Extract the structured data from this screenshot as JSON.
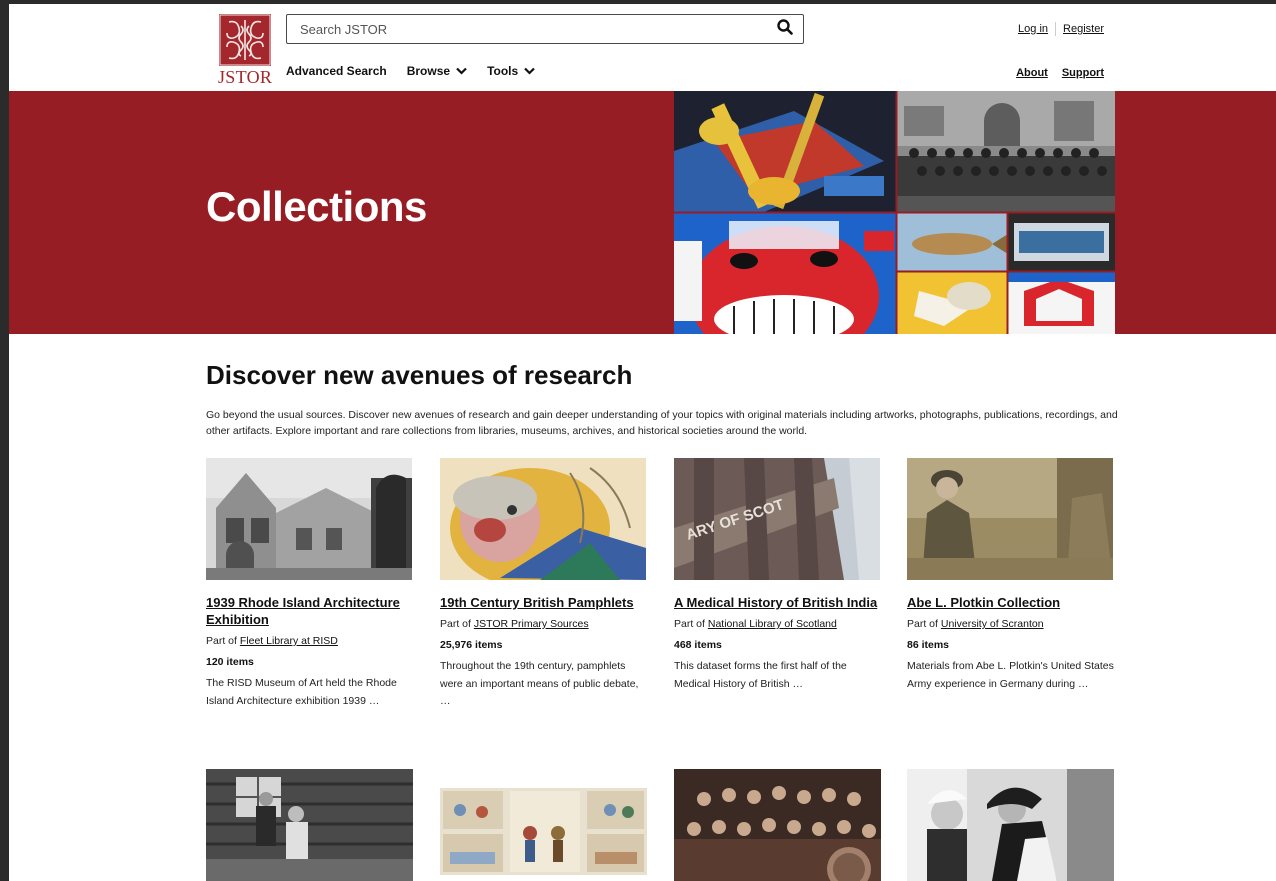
{
  "header": {
    "logo_text": "JSTOR",
    "search_placeholder": "Search JSTOR",
    "nav": {
      "advanced_search": "Advanced Search",
      "browse": "Browse",
      "tools": "Tools"
    },
    "links": {
      "login": "Log in",
      "register": "Register",
      "about": "About",
      "support": "Support"
    }
  },
  "hero": {
    "title": "Collections"
  },
  "main": {
    "heading": "Discover new avenues of research",
    "intro": "Go beyond the usual sources. Discover new avenues of research and gain deeper understanding of your topics with original materials including artworks, photographs, publications, recordings, and other artifacts. Explore important and rare collections from libraries, museums, archives, and historical societies around the world.",
    "part_of_prefix": "Part of",
    "cards": [
      {
        "title": "1939 Rhode Island Architecture Exhibition",
        "source": "Fleet Library at RISD",
        "count": "120 items",
        "description": "The RISD Museum of Art held the Rhode Island Architecture exhibition 1939 …"
      },
      {
        "title": "19th Century British Pamphlets",
        "source": "JSTOR Primary Sources",
        "count": "25,976 items",
        "description": "Throughout the 19th century, pamphlets were an important means of public debate, …"
      },
      {
        "title": "A Medical History of British India",
        "source": "National Library of Scotland",
        "count": "468 items",
        "description": "This dataset forms the first half of the Medical History of British …"
      },
      {
        "title": "Abe L. Plotkin Collection",
        "source": "University of Scranton",
        "count": "86 items",
        "description": "Materials from Abe L. Plotkin's United States Army experience in Germany during …"
      }
    ]
  },
  "colors": {
    "brand_red": "#961d23",
    "logo_red": "#a3272c",
    "window_frame": "#2b2b2b"
  },
  "icons": {
    "search": "search-icon",
    "browse_chevron": "chevron-down-icon",
    "tools_chevron": "chevron-down-icon"
  }
}
